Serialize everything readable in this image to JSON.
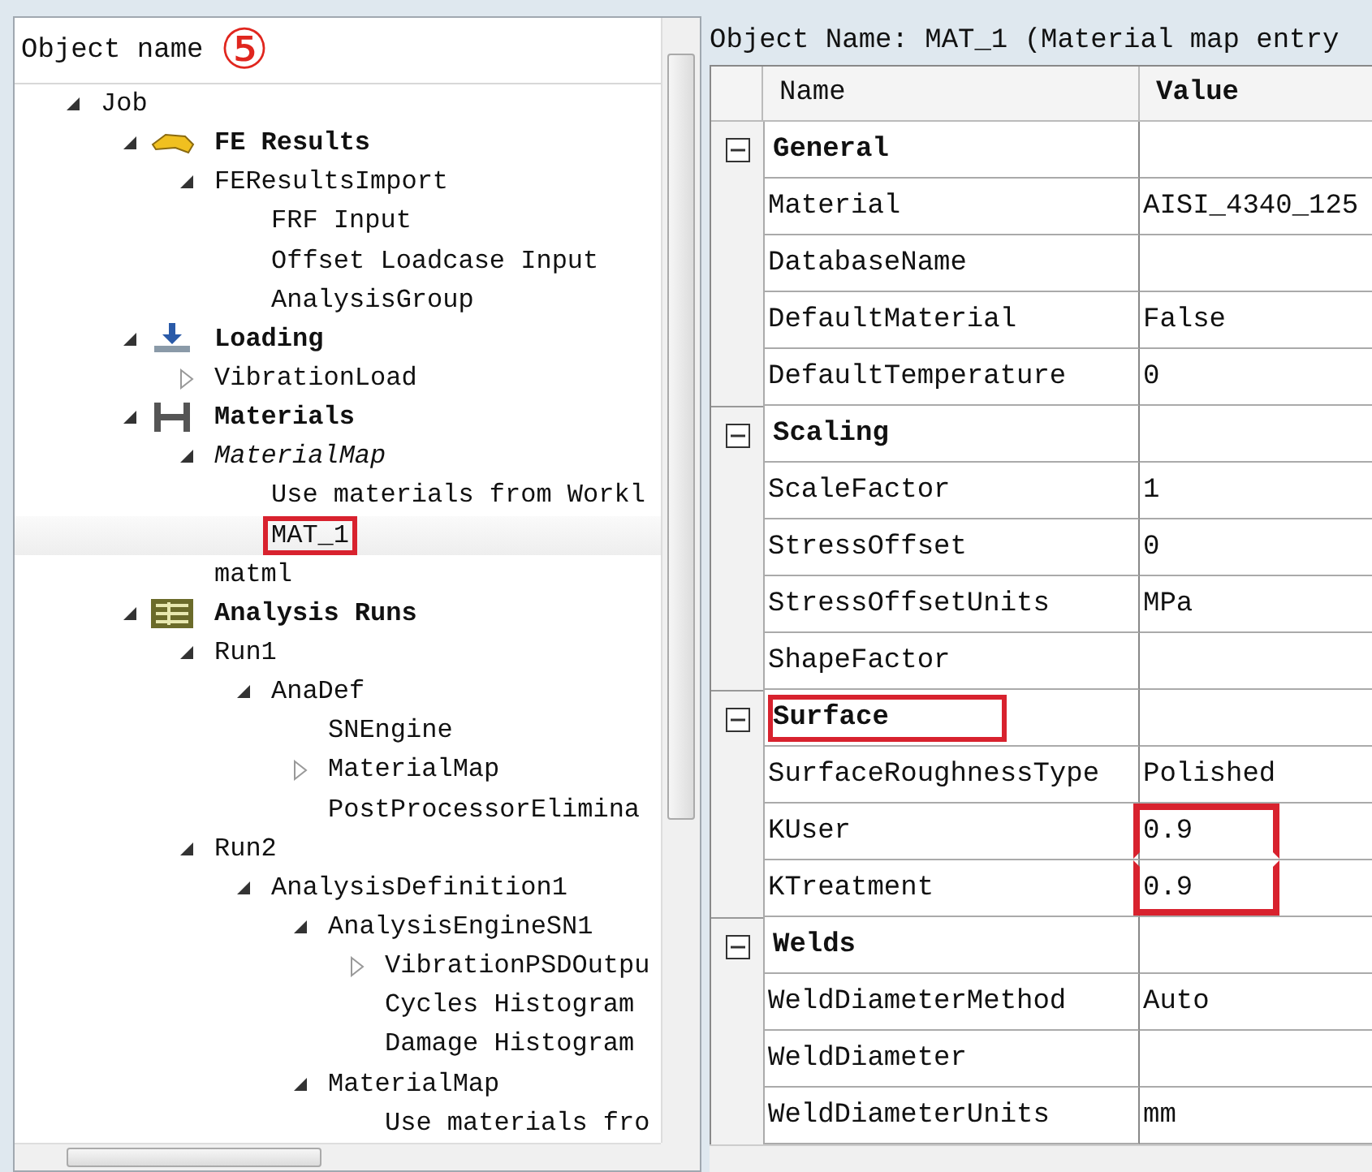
{
  "tree_panel": {
    "header": "Object name",
    "annotation": "⑤",
    "nodes": [
      {
        "label": "Job",
        "expanded": true,
        "selected": false,
        "marked": false,
        "children": [
          {
            "label": "FE Results",
            "kind": "results",
            "expanded": true,
            "selected": false,
            "marked": false,
            "children": [
              {
                "label": "FEResultsImport",
                "expanded": true,
                "selected": false,
                "marked": false,
                "children": [
                  {
                    "label": "FRF Input",
                    "selected": false,
                    "marked": false
                  },
                  {
                    "label": "Offset Loadcase Input",
                    "selected": false,
                    "marked": false
                  },
                  {
                    "label": "AnalysisGroup",
                    "selected": false,
                    "marked": false
                  }
                ]
              }
            ]
          },
          {
            "label": "Loading",
            "kind": "loading",
            "expanded": true,
            "selected": false,
            "marked": false,
            "children": [
              {
                "label": "VibrationLoad",
                "expanded": false,
                "selected": false,
                "marked": false
              }
            ]
          },
          {
            "label": "Materials",
            "kind": "materials",
            "expanded": true,
            "selected": false,
            "marked": false,
            "children": [
              {
                "label": "MaterialMap",
                "italic": true,
                "expanded": true,
                "selected": false,
                "marked": false,
                "children": [
                  {
                    "label": "Use materials from Workl",
                    "selected": false,
                    "marked": false
                  },
                  {
                    "label": "MAT_1",
                    "selected": true,
                    "marked": true
                  }
                ]
              },
              {
                "label": "matml",
                "selected": false,
                "marked": false
              }
            ]
          },
          {
            "label": "Analysis Runs",
            "kind": "runs",
            "expanded": true,
            "selected": false,
            "marked": false,
            "children": [
              {
                "label": "Run1",
                "expanded": true,
                "selected": false,
                "marked": false,
                "children": [
                  {
                    "label": "AnaDef",
                    "expanded": true,
                    "selected": false,
                    "marked": false,
                    "children": [
                      {
                        "label": "SNEngine",
                        "selected": false,
                        "marked": false
                      },
                      {
                        "label": "MaterialMap",
                        "expanded": false,
                        "selected": false,
                        "marked": false
                      },
                      {
                        "label": "PostProcessorElimina",
                        "selected": false,
                        "marked": false
                      }
                    ]
                  }
                ]
              },
              {
                "label": "Run2",
                "expanded": true,
                "selected": false,
                "marked": false,
                "children": [
                  {
                    "label": "AnalysisDefinition1",
                    "expanded": true,
                    "selected": false,
                    "marked": false,
                    "children": [
                      {
                        "label": "AnalysisEngineSN1",
                        "expanded": true,
                        "selected": false,
                        "marked": false,
                        "children": [
                          {
                            "label": "VibrationPSDOutpu",
                            "expanded": false,
                            "selected": false,
                            "marked": false
                          },
                          {
                            "label": "Cycles Histogram",
                            "selected": false,
                            "marked": false
                          },
                          {
                            "label": "Damage Histogram",
                            "selected": false,
                            "marked": false
                          }
                        ]
                      },
                      {
                        "label": "MaterialMap",
                        "expanded": true,
                        "selected": false,
                        "marked": false,
                        "children": [
                          {
                            "label": "Use materials fro",
                            "selected": false,
                            "marked": false
                          }
                        ]
                      }
                    ]
                  }
                ]
              }
            ]
          }
        ]
      }
    ]
  },
  "property_panel": {
    "title": "Object Name: MAT_1 (Material map entry",
    "columns": [
      "Name",
      "Value"
    ],
    "groups": [
      {
        "name": "General",
        "expanded": true,
        "marked": false,
        "rows": [
          {
            "name": "Material",
            "value": "AISI_4340_125",
            "marked": false
          },
          {
            "name": "DatabaseName",
            "marked": false
          },
          {
            "name": "DefaultMaterial",
            "value": "False",
            "marked": false
          },
          {
            "name": "DefaultTemperature",
            "value": "0",
            "marked": false
          }
        ]
      },
      {
        "name": "Scaling",
        "expanded": true,
        "marked": false,
        "rows": [
          {
            "name": "ScaleFactor",
            "value": "1",
            "marked": false
          },
          {
            "name": "StressOffset",
            "value": "0",
            "marked": false
          },
          {
            "name": "StressOffsetUnits",
            "value": "MPa",
            "marked": false
          },
          {
            "name": "ShapeFactor",
            "marked": false
          }
        ]
      },
      {
        "name": "Surface",
        "expanded": true,
        "marked": true,
        "rows": [
          {
            "name": "SurfaceRoughnessType",
            "value": "Polished",
            "marked": false
          },
          {
            "name": "KUser",
            "value": "0.9",
            "marked": true
          },
          {
            "name": "KTreatment",
            "value": "0.9",
            "marked": true
          }
        ]
      },
      {
        "name": "Welds",
        "expanded": true,
        "marked": false,
        "rows": [
          {
            "name": "WeldDiameterMethod",
            "value": "Auto",
            "marked": false
          },
          {
            "name": "WeldDiameter",
            "marked": false
          },
          {
            "name": "WeldDiameterUnits",
            "value": "mm",
            "marked": false
          }
        ]
      }
    ]
  }
}
